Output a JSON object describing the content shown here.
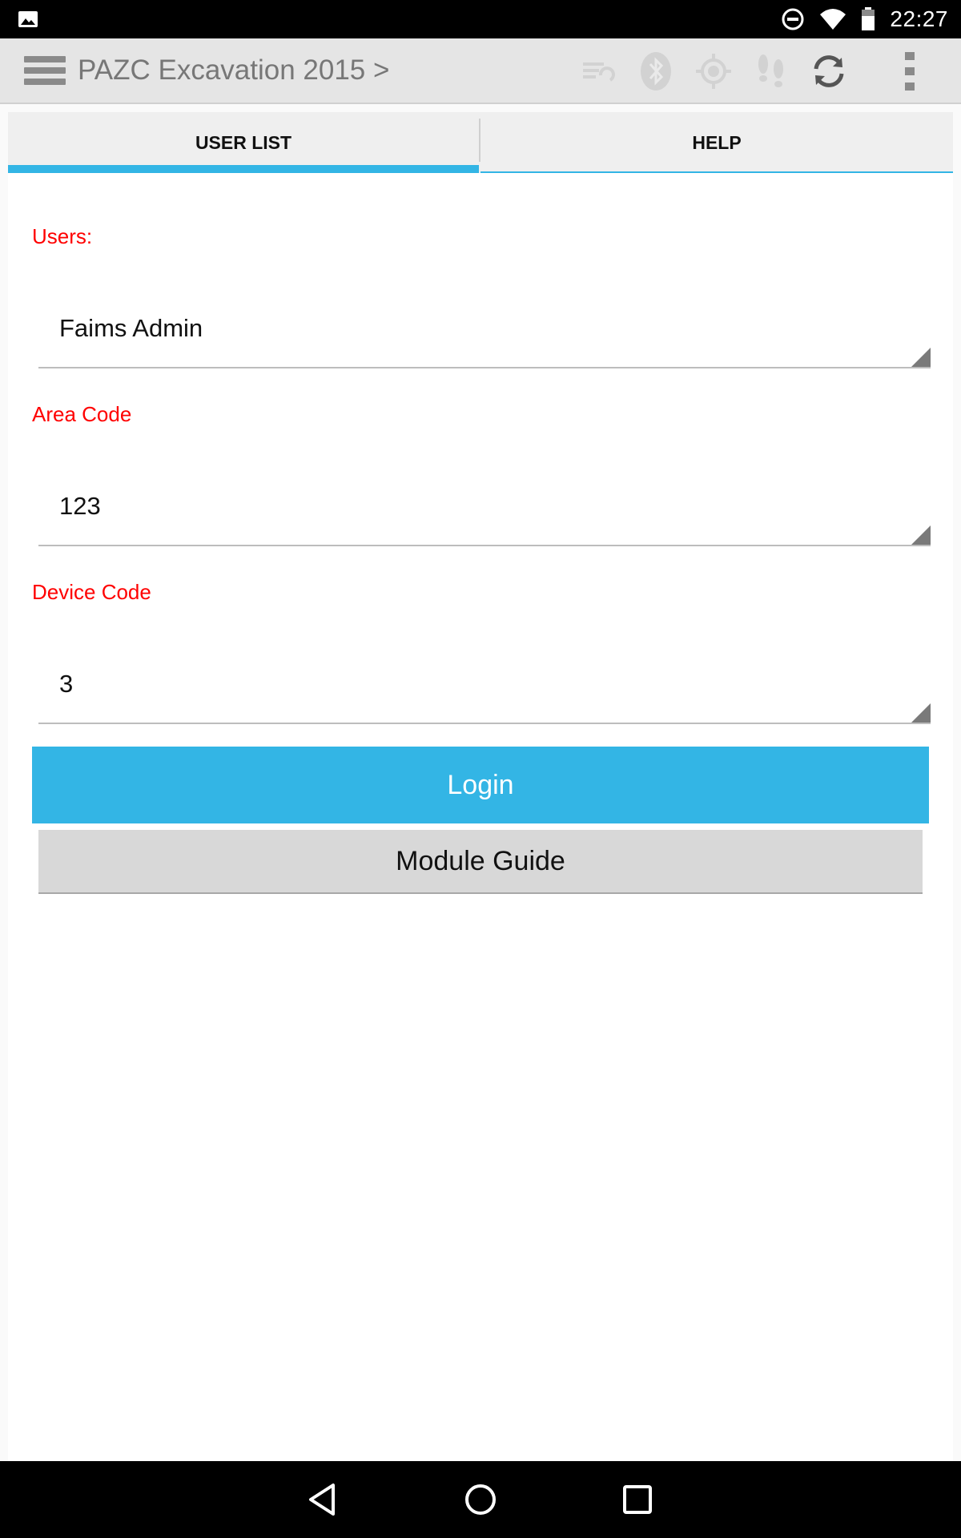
{
  "status_bar": {
    "time": "22:27",
    "icons": [
      "image-icon",
      "dnd-icon",
      "wifi-icon",
      "battery-icon"
    ]
  },
  "action_bar": {
    "title": "PAZC Excavation 2015 >",
    "icons": [
      "menu-icon",
      "sync-status-icon",
      "bluetooth-icon",
      "gps-icon",
      "tracking-icon",
      "sync-icon",
      "overflow-menu-icon"
    ]
  },
  "tabs": [
    {
      "label": "USER LIST",
      "selected": true
    },
    {
      "label": "HELP",
      "selected": false
    }
  ],
  "form": {
    "users_label": "Users:",
    "users_value": "Faims Admin",
    "area_code_label": "Area Code",
    "area_code_value": "123",
    "device_code_label": "Device Code",
    "device_code_value": "3"
  },
  "buttons": {
    "login": "Login",
    "module_guide": "Module Guide"
  },
  "nav_bar": {
    "icons": [
      "back-icon",
      "home-icon",
      "recents-icon"
    ]
  },
  "colors": {
    "accent": "#33b5e5",
    "label_red": "#ff0000",
    "action_bar_bg": "#e5e5e5"
  }
}
